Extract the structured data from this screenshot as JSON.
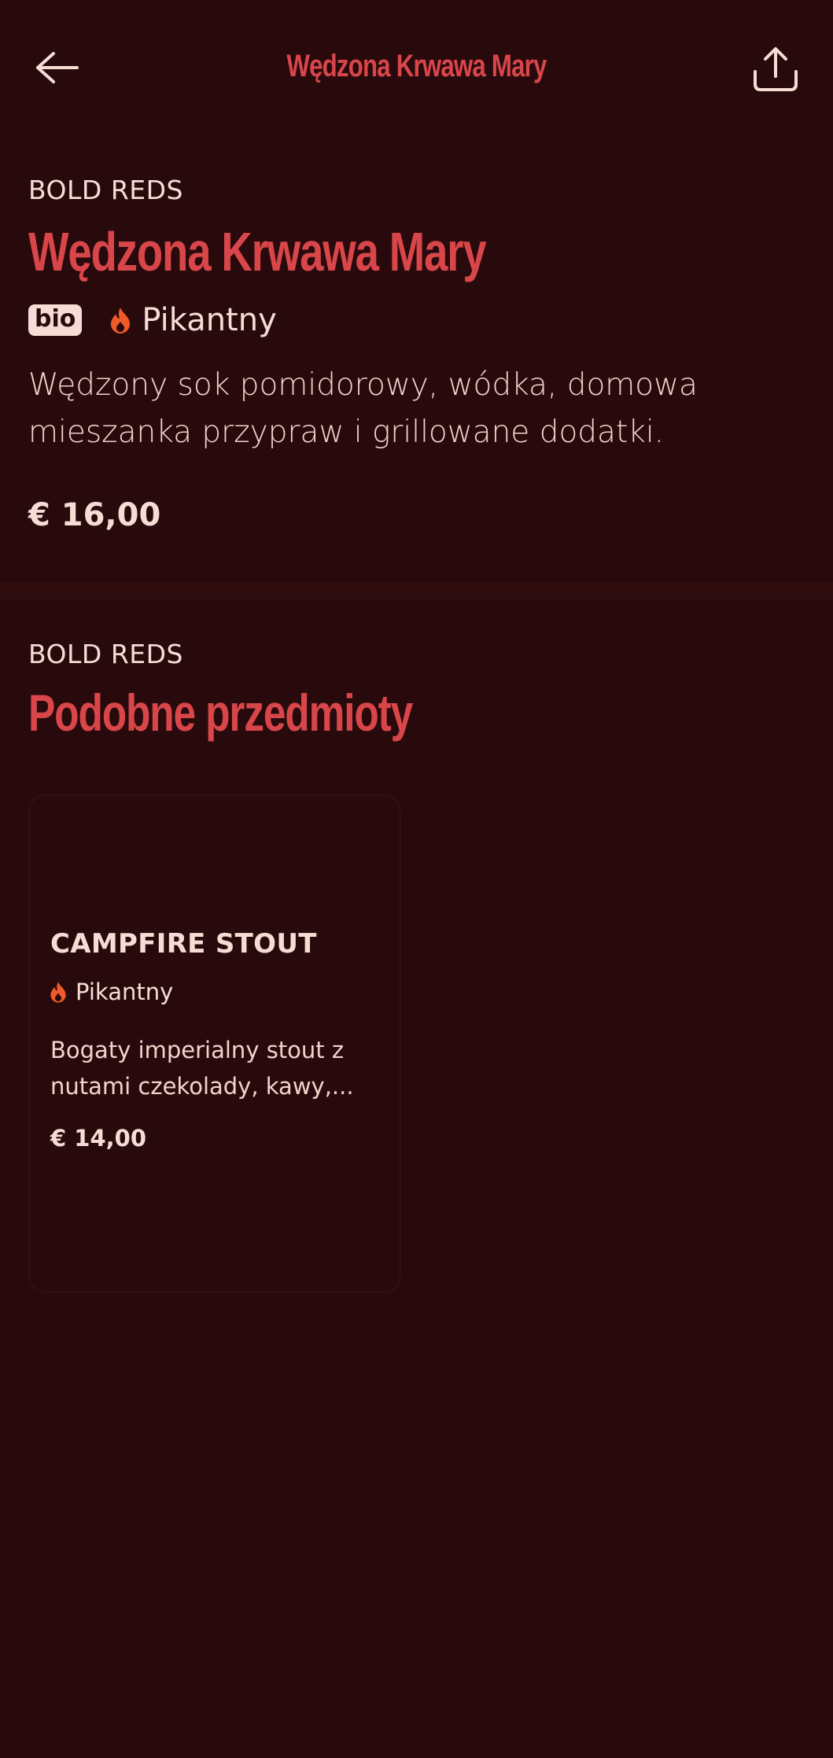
{
  "header": {
    "title": "Wędzona Krwawa Mary",
    "back_icon": "arrow-left-icon",
    "share_icon": "share-upload-icon"
  },
  "item": {
    "category": "BOLD REDS",
    "name": "Wędzona Krwawa Mary",
    "badge": "bio",
    "spicy_label": "Pikantny",
    "description": "Wędzony sok pomidorowy, wódka, domowa mieszanka przypraw i grillowane dodatki.",
    "price": "€ 16,00"
  },
  "similar": {
    "category": "BOLD REDS",
    "title": "Podobne przedmioty",
    "items": [
      {
        "name": "CAMPFIRE STOUT",
        "spicy_label": "Pikantny",
        "description": "Bogaty imperialny stout z nutami czekolady, kawy,...",
        "price": "€ 14,00"
      }
    ]
  },
  "colors": {
    "background": "#290a0c",
    "accent": "#d8464a",
    "text": "#f7dcd6",
    "flame": "#f05a28"
  }
}
